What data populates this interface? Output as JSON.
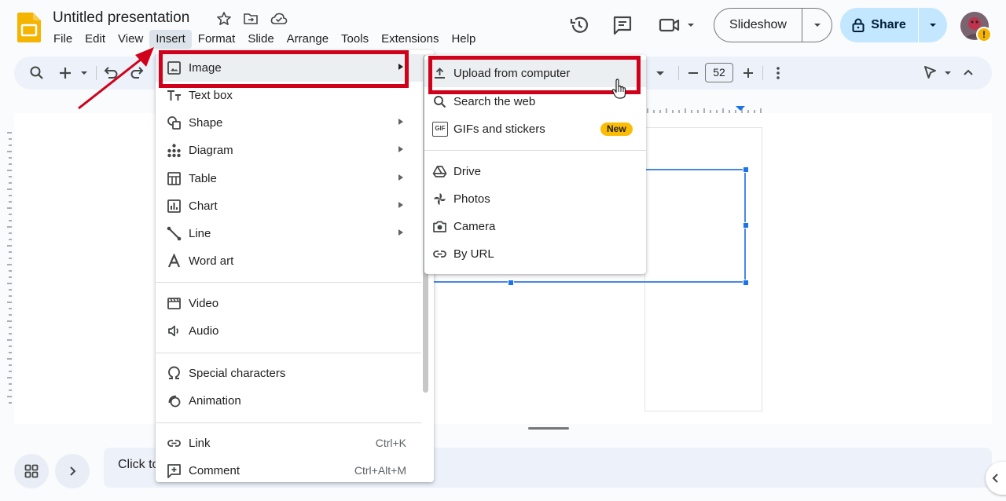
{
  "header": {
    "doc_title": "Untitled presentation",
    "menus": [
      "File",
      "Edit",
      "View",
      "Insert",
      "Format",
      "Slide",
      "Arrange",
      "Tools",
      "Extensions",
      "Help"
    ],
    "active_menu": "Insert",
    "slideshow_label": "Slideshow",
    "share_label": "Share",
    "avatar_badge": "!"
  },
  "toolbar": {
    "zoom_value": "52"
  },
  "insert_menu": {
    "image": "Image",
    "text_box": "Text box",
    "shape": "Shape",
    "diagram": "Diagram",
    "table": "Table",
    "chart": "Chart",
    "line": "Line",
    "word_art": "Word art",
    "video": "Video",
    "audio": "Audio",
    "special_characters": "Special characters",
    "animation": "Animation",
    "link": "Link",
    "link_shortcut": "Ctrl+K",
    "comment": "Comment",
    "comment_shortcut": "Ctrl+Alt+M"
  },
  "image_submenu": {
    "upload": "Upload from computer",
    "search_web": "Search the web",
    "gifs": "GIFs and stickers",
    "new_badge": "New",
    "drive": "Drive",
    "photos": "Photos",
    "camera": "Camera",
    "by_url": "By URL",
    "gif_icon_text": "GIF"
  },
  "notes": {
    "placeholder": "Click to"
  },
  "colors": {
    "annotation_red": "#d0021b",
    "accent_blue": "#1a73e8",
    "share_bg": "#c2e7ff",
    "logo_yellow": "#f4b400"
  }
}
